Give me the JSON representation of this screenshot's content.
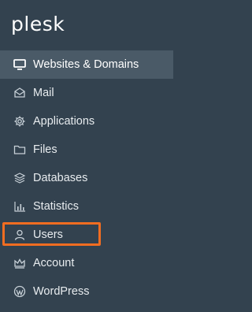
{
  "brand": {
    "logo_text": "plesk"
  },
  "nav": {
    "items": [
      {
        "label": "Websites & Domains",
        "icon": "monitor-icon",
        "active": true
      },
      {
        "label": "Mail",
        "icon": "envelope-icon"
      },
      {
        "label": "Applications",
        "icon": "gear-icon"
      },
      {
        "label": "Files",
        "icon": "folder-icon"
      },
      {
        "label": "Databases",
        "icon": "database-icon"
      },
      {
        "label": "Statistics",
        "icon": "bar-chart-icon"
      },
      {
        "label": "Users",
        "icon": "user-icon",
        "highlighted": true
      },
      {
        "label": "Account",
        "icon": "crown-icon"
      },
      {
        "label": "WordPress",
        "icon": "wordpress-icon"
      }
    ]
  },
  "colors": {
    "sidebar_bg": "#33424f",
    "active_bg": "#4a5a67",
    "highlight_border": "#f26d21",
    "text": "#e8ecef"
  }
}
